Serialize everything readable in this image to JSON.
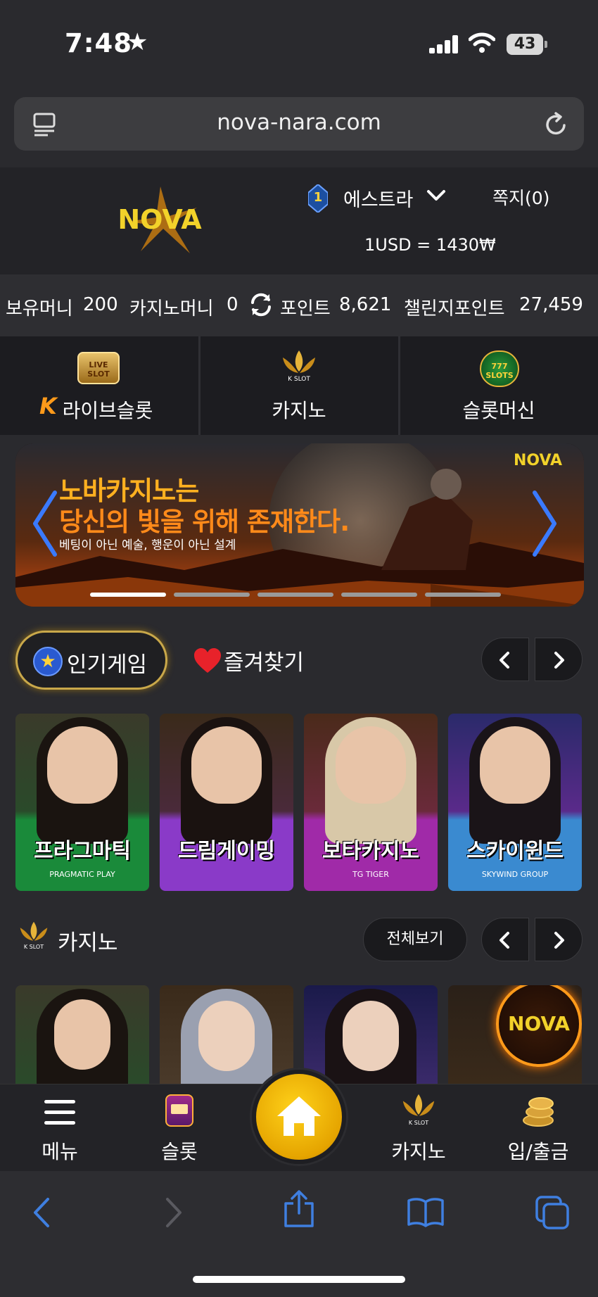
{
  "status_bar": {
    "time": "7:48",
    "battery": "43"
  },
  "browser": {
    "url": "nova-nara.com"
  },
  "header": {
    "logo_text": "NOVA",
    "level_badge": "1",
    "username": "에스트라",
    "memo": "쪽지(0)",
    "exchange_rate": "1USD = 1430₩"
  },
  "balances": {
    "money_label": "보유머니",
    "money_value": "200",
    "casino_money_label": "카지노머니",
    "casino_money_value": "0",
    "points_label": "포인트",
    "points_value": "8,621",
    "challenge_label": "챌린지포인트",
    "challenge_value": "27,459"
  },
  "categories": [
    {
      "label": "라이브슬롯",
      "icon_text": "LIVE SLOT",
      "icon": "live-slot-icon"
    },
    {
      "label": "카지노",
      "icon_text": "K SLOT",
      "icon": "k-slot-crown-icon"
    },
    {
      "label": "슬롯머신",
      "icon_text": "777 SLOTS",
      "icon": "slots-777-icon"
    }
  ],
  "banner": {
    "line1": "노바카지노는",
    "line2": "당신의 빛을 위해 존재한다.",
    "line3": "베팅이 아닌 예술, 행운이 아닌 설계",
    "logo": "NOVA",
    "slides": 5,
    "active_slide": 1
  },
  "tabs": {
    "popular": "인기게임",
    "favorites": "즐겨찾기"
  },
  "popular_games": [
    {
      "name": "프라그마틱",
      "brand": "PRAGMATIC PLAY",
      "bg": "#1a8a3a"
    },
    {
      "name": "드림게이밍",
      "brand": "",
      "bg": "#8a3ac8"
    },
    {
      "name": "보타카지노",
      "brand": "TG TIGER",
      "bg": "#a02aa8"
    },
    {
      "name": "스카이윈드",
      "brand": "SKYWIND GROUP",
      "bg": "#3a8ad0"
    }
  ],
  "casino_section": {
    "title": "카지노",
    "view_all": "전체보기",
    "icon_text": "K SLOT"
  },
  "bottom_nav": [
    {
      "label": "메뉴",
      "icon": "hamburger-icon"
    },
    {
      "label": "슬롯",
      "icon": "slot-machine-icon"
    },
    {
      "label": "",
      "icon": "home-icon"
    },
    {
      "label": "카지노",
      "icon": "k-slot-crown-icon",
      "icon_text": "K SLOT"
    },
    {
      "label": "입/출금",
      "icon": "coin-stack-icon"
    }
  ],
  "colors": {
    "accent_gold": "#e5a400",
    "safari_blue": "#3f7fe0",
    "bg": "#2a2a2e"
  }
}
